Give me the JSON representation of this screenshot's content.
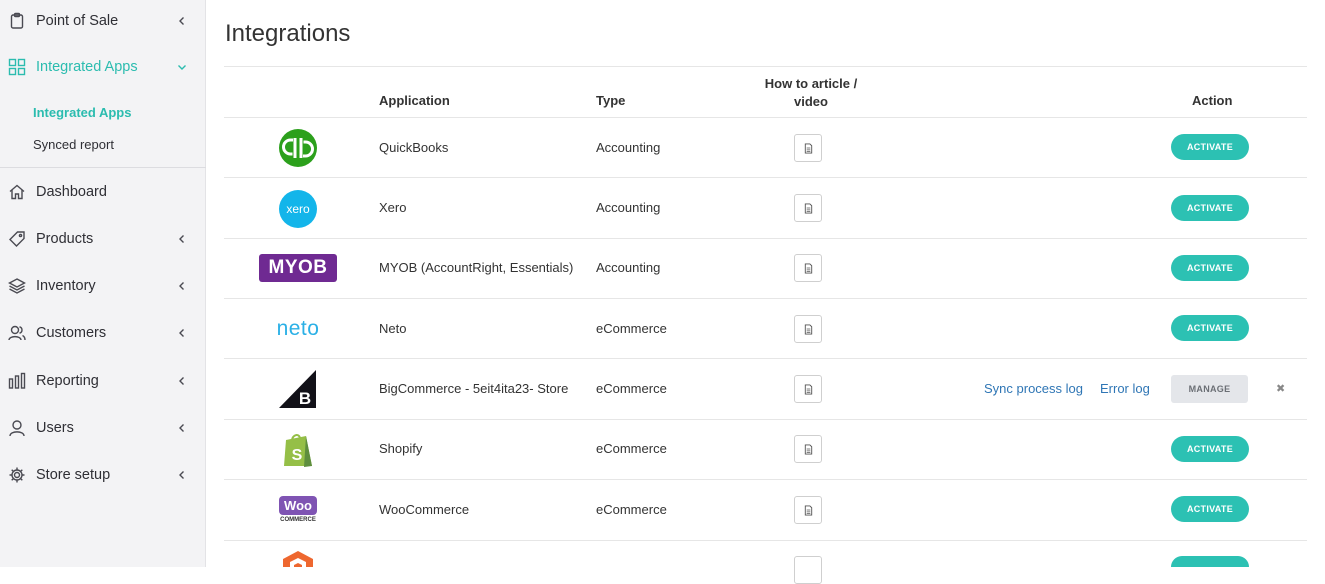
{
  "sidebar": {
    "items": [
      {
        "label": "Point of Sale"
      },
      {
        "label": "Integrated Apps"
      },
      {
        "label": "Dashboard"
      },
      {
        "label": "Products"
      },
      {
        "label": "Inventory"
      },
      {
        "label": "Customers"
      },
      {
        "label": "Reporting"
      },
      {
        "label": "Users"
      },
      {
        "label": "Store setup"
      }
    ],
    "sub_items": [
      {
        "label": "Integrated Apps"
      },
      {
        "label": "Synced report"
      }
    ],
    "accent_color": "#2bbcaf"
  },
  "main": {
    "title": "Integrations",
    "headers": {
      "application": "Application",
      "type": "Type",
      "howto_line1": "How to article /",
      "howto_line2": "video",
      "action": "Action"
    },
    "rows": [
      {
        "application": "QuickBooks",
        "type": "Accounting",
        "action": "ACTIVATE",
        "logo": "quickbooks-logo"
      },
      {
        "application": "Xero",
        "type": "Accounting",
        "action": "ACTIVATE",
        "logo": "xero-logo"
      },
      {
        "application": "MYOB (AccountRight, Essentials)",
        "type": "Accounting",
        "action": "ACTIVATE",
        "logo": "myob-logo",
        "logo_text": "MYOB"
      },
      {
        "application": "Neto",
        "type": "eCommerce",
        "action": "ACTIVATE",
        "logo": "neto-logo",
        "logo_text": "neto"
      },
      {
        "application": "BigCommerce - 5eit4ita23- Store",
        "type": "eCommerce",
        "action": "MANAGE",
        "logo": "bigcommerce-logo",
        "sync_link": "Sync process log",
        "error_link": "Error log"
      },
      {
        "application": "Shopify",
        "type": "eCommerce",
        "action": "ACTIVATE",
        "logo": "shopify-logo"
      },
      {
        "application": "WooCommerce",
        "type": "eCommerce",
        "action": "ACTIVATE",
        "logo": "woocommerce-logo",
        "logo_text": "Woo",
        "logo_subtext": "COMMERCE"
      }
    ],
    "activate_color": "#2cc1b3",
    "link_color": "#2f76b5"
  }
}
